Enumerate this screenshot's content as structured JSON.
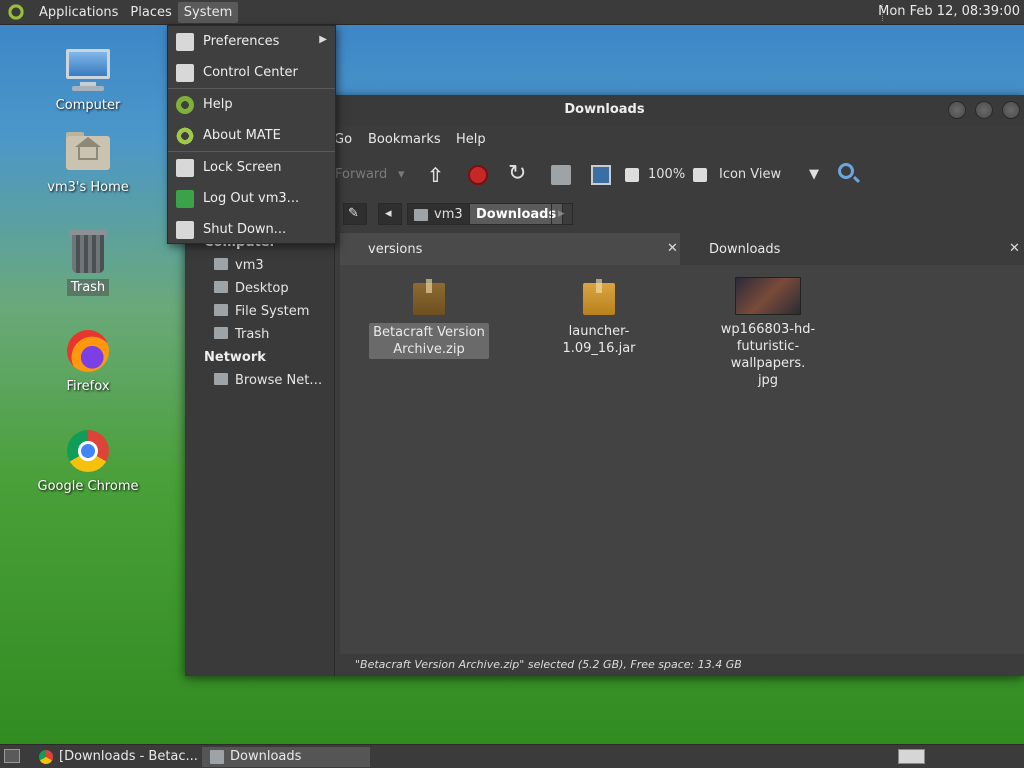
{
  "top_panel": {
    "menus": [
      "Applications",
      "Places",
      "System"
    ],
    "clock": "Mon Feb 12, 08:39:00"
  },
  "desktop_icons": [
    {
      "label": "Computer",
      "icon": "computer-icon"
    },
    {
      "label": "vm3's Home",
      "icon": "home-folder-icon"
    },
    {
      "label": "Trash",
      "icon": "trash-icon"
    },
    {
      "label": "Firefox",
      "icon": "firefox-icon"
    },
    {
      "label": "Google Chrome",
      "icon": "chrome-icon"
    }
  ],
  "system_menu": {
    "items": [
      {
        "label": "Preferences",
        "icon": "preferences-icon",
        "submenu": true
      },
      {
        "label": "Control Center",
        "icon": "control-center-icon"
      },
      {
        "label": "Help",
        "icon": "help-icon"
      },
      {
        "label": "About MATE",
        "icon": "mate-icon"
      },
      {
        "label": "Lock Screen",
        "icon": "lock-icon"
      },
      {
        "label": "Log Out vm3...",
        "icon": "logout-icon"
      },
      {
        "label": "Shut Down...",
        "icon": "shutdown-icon"
      }
    ]
  },
  "file_manager": {
    "title": "Downloads",
    "menubar": [
      "Go",
      "Bookmarks",
      "Help"
    ],
    "toolbar": {
      "forward": "Forward",
      "zoom": "100%",
      "view": "Icon View"
    },
    "path": [
      "vm3",
      "Downloads"
    ],
    "sidebar": {
      "computer_header": "Computer",
      "computer_items": [
        "vm3",
        "Desktop",
        "File System",
        "Trash"
      ],
      "network_header": "Network",
      "network_items": [
        "Browse Net…"
      ]
    },
    "tabs": [
      "versions",
      "Downloads"
    ],
    "files": [
      {
        "name_line1": "Betacraft Version",
        "name_line2": "Archive.zip",
        "type": "archive-icon",
        "selected": true
      },
      {
        "name_line1": "launcher-1.09_16.jar",
        "name_line2": "",
        "type": "archive-icon",
        "selected": false
      },
      {
        "name_line1": "wp166803-hd-",
        "name_line2": "futuristic-wallpapers.",
        "name_line3": "jpg",
        "type": "image-thumbnail",
        "selected": false
      }
    ],
    "status": "\"Betacraft Version Archive.zip\" selected (5.2 GB), Free space: 13.4 GB"
  },
  "taskbar": {
    "tasks": [
      "[Downloads - Betac...",
      "Downloads"
    ]
  }
}
